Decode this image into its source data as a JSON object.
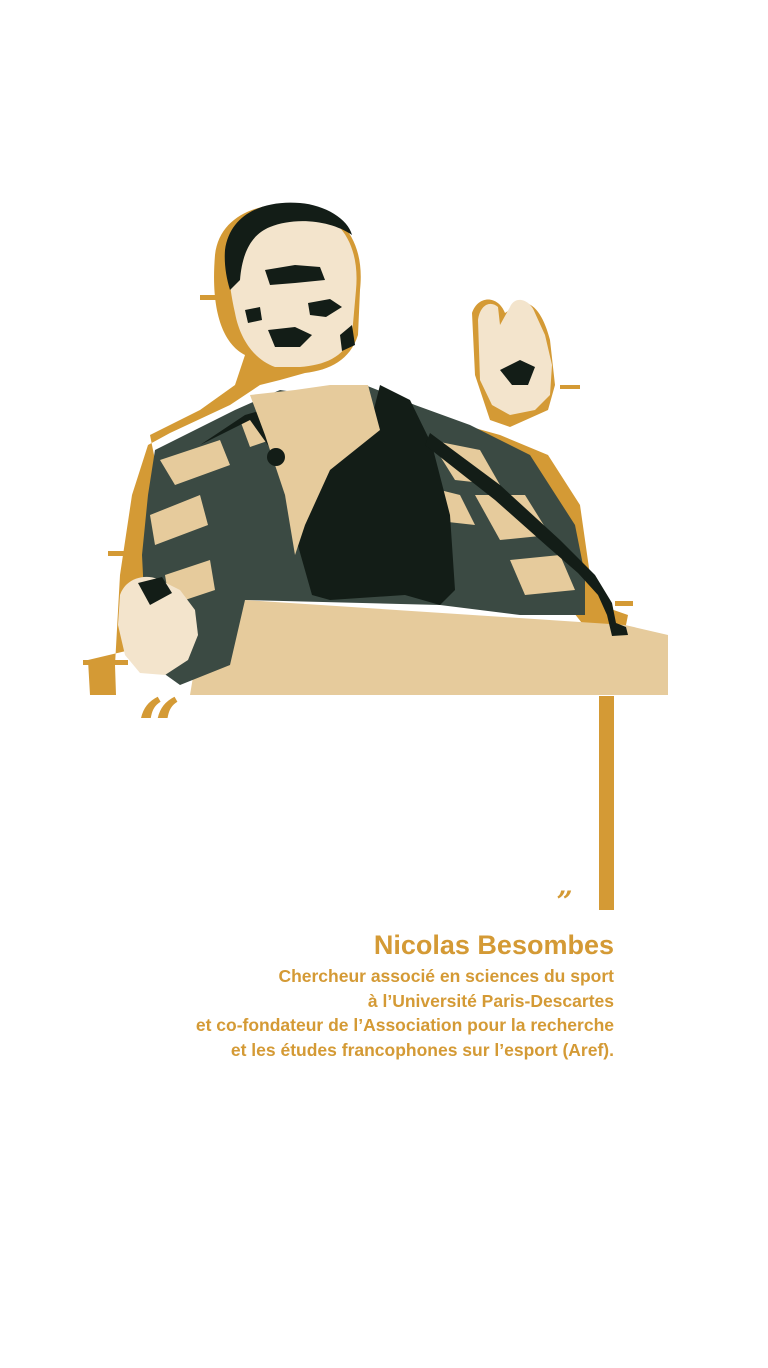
{
  "colors": {
    "gold": "#d49a35",
    "cream": "#f3e4cc",
    "sand": "#e6cb9c",
    "dark": "#131d17",
    "slate": "#3b4a43",
    "background": "#ffffff"
  },
  "illustration": {
    "icon": "speaker-at-podium-illustration"
  },
  "quote": {
    "open_mark": "“",
    "close_mark": "„",
    "text": ""
  },
  "author": {
    "name": "Nicolas Besombes",
    "bio_lines": [
      "Chercheur associé en sciences du sport",
      "à l’Université Paris-Descartes",
      "et co-fondateur de l’Association pour la recherche",
      "et les études francophones sur l’esport (Aref)."
    ]
  }
}
